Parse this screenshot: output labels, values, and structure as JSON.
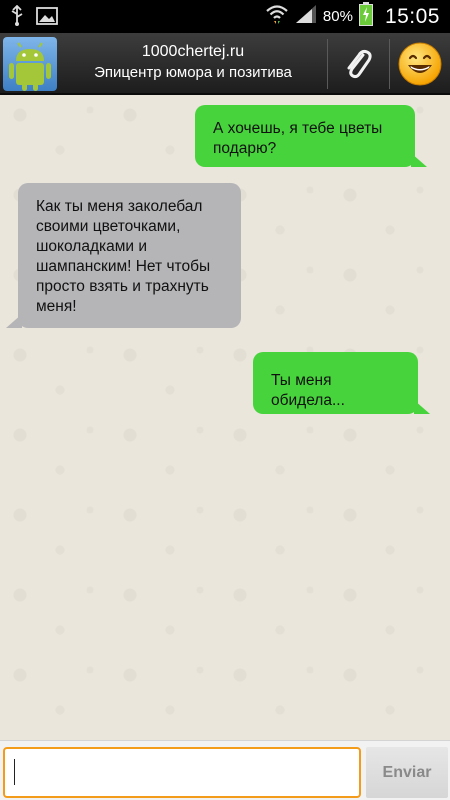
{
  "status_bar": {
    "icons": [
      "usb-icon",
      "image-icon",
      "wifi-icon",
      "signal-icon",
      "battery-icon"
    ],
    "battery_percent": "80%",
    "time": "15:05"
  },
  "header": {
    "title": "1000chertej.ru",
    "subtitle": "Эпицентр юмора и позитива",
    "avatar_icon": "android-icon",
    "attach_icon": "paperclip-icon",
    "emoji_icon": "smiley-icon"
  },
  "messages": [
    {
      "direction": "outgoing",
      "text": "А хочешь, я тебе цветы подарю?"
    },
    {
      "direction": "incoming",
      "text": "Как ты меня заколебал своими цветочками, шоколадками и шампанским! Нет чтобы просто взять и трахнуть меня!"
    },
    {
      "direction": "outgoing",
      "text": "Ты меня обидела..."
    }
  ],
  "input": {
    "value": "",
    "send_label": "Enviar"
  },
  "colors": {
    "outgoing_bubble": "#47d33c",
    "incoming_bubble": "#b5b5b8",
    "input_border": "#f39c1c",
    "chat_background": "#ebe6dc"
  }
}
